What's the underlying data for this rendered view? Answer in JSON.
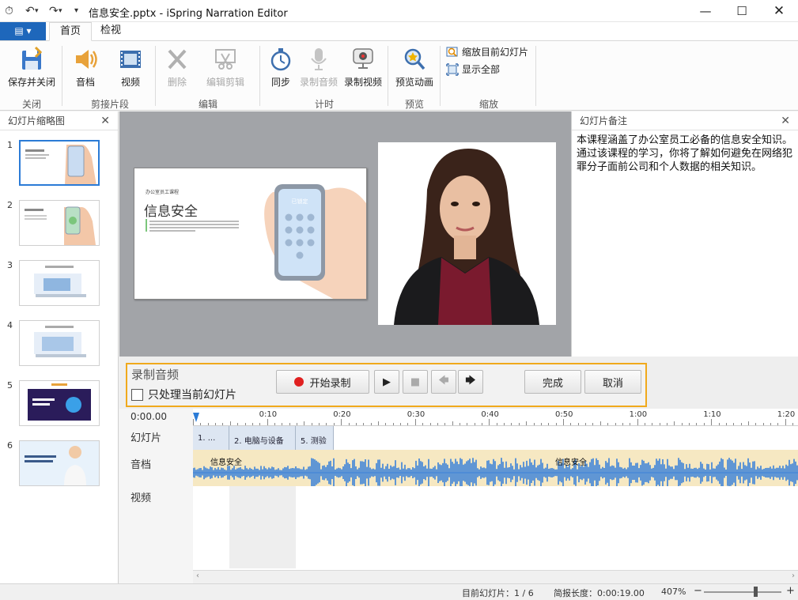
{
  "window": {
    "title": "信息安全.pptx - iSpring Narration Editor"
  },
  "tabs": {
    "file_label": "▤ ▾",
    "home": "首页",
    "review": "检视"
  },
  "ribbon": {
    "save_close": "保存并关闭",
    "audio": "音档",
    "video": "视频",
    "delete": "删除",
    "edit_clip": "编辑剪辑",
    "sync": "同步",
    "record_audio": "录制音频",
    "record_video": "录制视频",
    "preview_anim": "预览动画",
    "zoom_current": "缩放目前幻灯片",
    "show_all": "显示全部",
    "groups": {
      "close": "关闭",
      "clip": "剪接片段",
      "edit": "编辑",
      "timing": "计时",
      "preview": "预览",
      "zoom": "缩放"
    }
  },
  "slides_panel": {
    "title": "幻灯片缩略图",
    "items": [
      {
        "num": "1"
      },
      {
        "num": "2"
      },
      {
        "num": "3"
      },
      {
        "num": "4"
      },
      {
        "num": "5"
      },
      {
        "num": "6"
      }
    ]
  },
  "slide": {
    "subtitle": "办公室员工课程",
    "title": "信息安全",
    "phone_label": "已锁定"
  },
  "notes": {
    "title": "幻灯片备注",
    "text": "本课程涵盖了办公室员工必备的信息安全知识。通过该课程的学习，你将了解如何避免在网络犯罪分子面前公司和个人数据的相关知识。"
  },
  "record": {
    "title": "录制音频",
    "only_current": "只处理当前幻灯片",
    "start": "开始录制",
    "done": "完成",
    "cancel": "取消"
  },
  "timeline": {
    "time_current": "0:00.00",
    "row_slides": "幻灯片",
    "row_audio": "音档",
    "row_video": "视频",
    "ticks": [
      "0:10",
      "0:20",
      "0:30",
      "0:40",
      "0:50",
      "1:00",
      "1:10",
      "1:20"
    ],
    "segments": [
      "1. ...",
      "2. 电脑与设备",
      "5. 测验"
    ],
    "audio_labels": [
      "信息安全",
      "信息安全"
    ]
  },
  "status": {
    "current_slide": "目前幻灯片：1 / 6",
    "duration": "简报长度：0:00:19.00",
    "zoom": "407%",
    "minus": "−",
    "plus": "+"
  },
  "colors": {
    "accent": "#1e67bb",
    "record_border": "#f0a91c",
    "record_dot": "#e02020",
    "waveform": "#3b82d8",
    "audio_bg": "#f6e8c2"
  }
}
